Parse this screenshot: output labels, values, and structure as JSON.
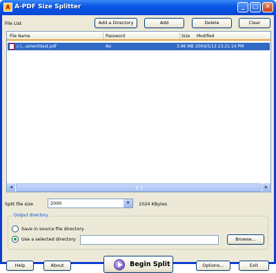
{
  "window": {
    "title": "A-PDF Size Splitter",
    "icon_letter": "A"
  },
  "toolbar": {
    "file_list_label": "File List",
    "add_directory": "Add a Directory",
    "add": "Add",
    "delete": "Delete",
    "clear": "Clear"
  },
  "list": {
    "columns": [
      "File Name",
      "Password",
      "Size",
      "Modified"
    ],
    "rows": [
      {
        "name": "c:\\...ument\\test.pdf",
        "password": "No",
        "size": "3.96 MB",
        "modified": "2004/5/13 23:21:14 PM"
      }
    ]
  },
  "split": {
    "label": "Split file size",
    "value": "2000",
    "unit": "1024 KBytes"
  },
  "output": {
    "legend": "Output directory",
    "option1": "Save in source file directory",
    "option2": "Use a selected directory",
    "browse": "Browse...",
    "path_value": ""
  },
  "footer": {
    "help": "Help",
    "about": "About",
    "begin": "Begin Split",
    "options": "Options...",
    "exit": "Exit"
  }
}
